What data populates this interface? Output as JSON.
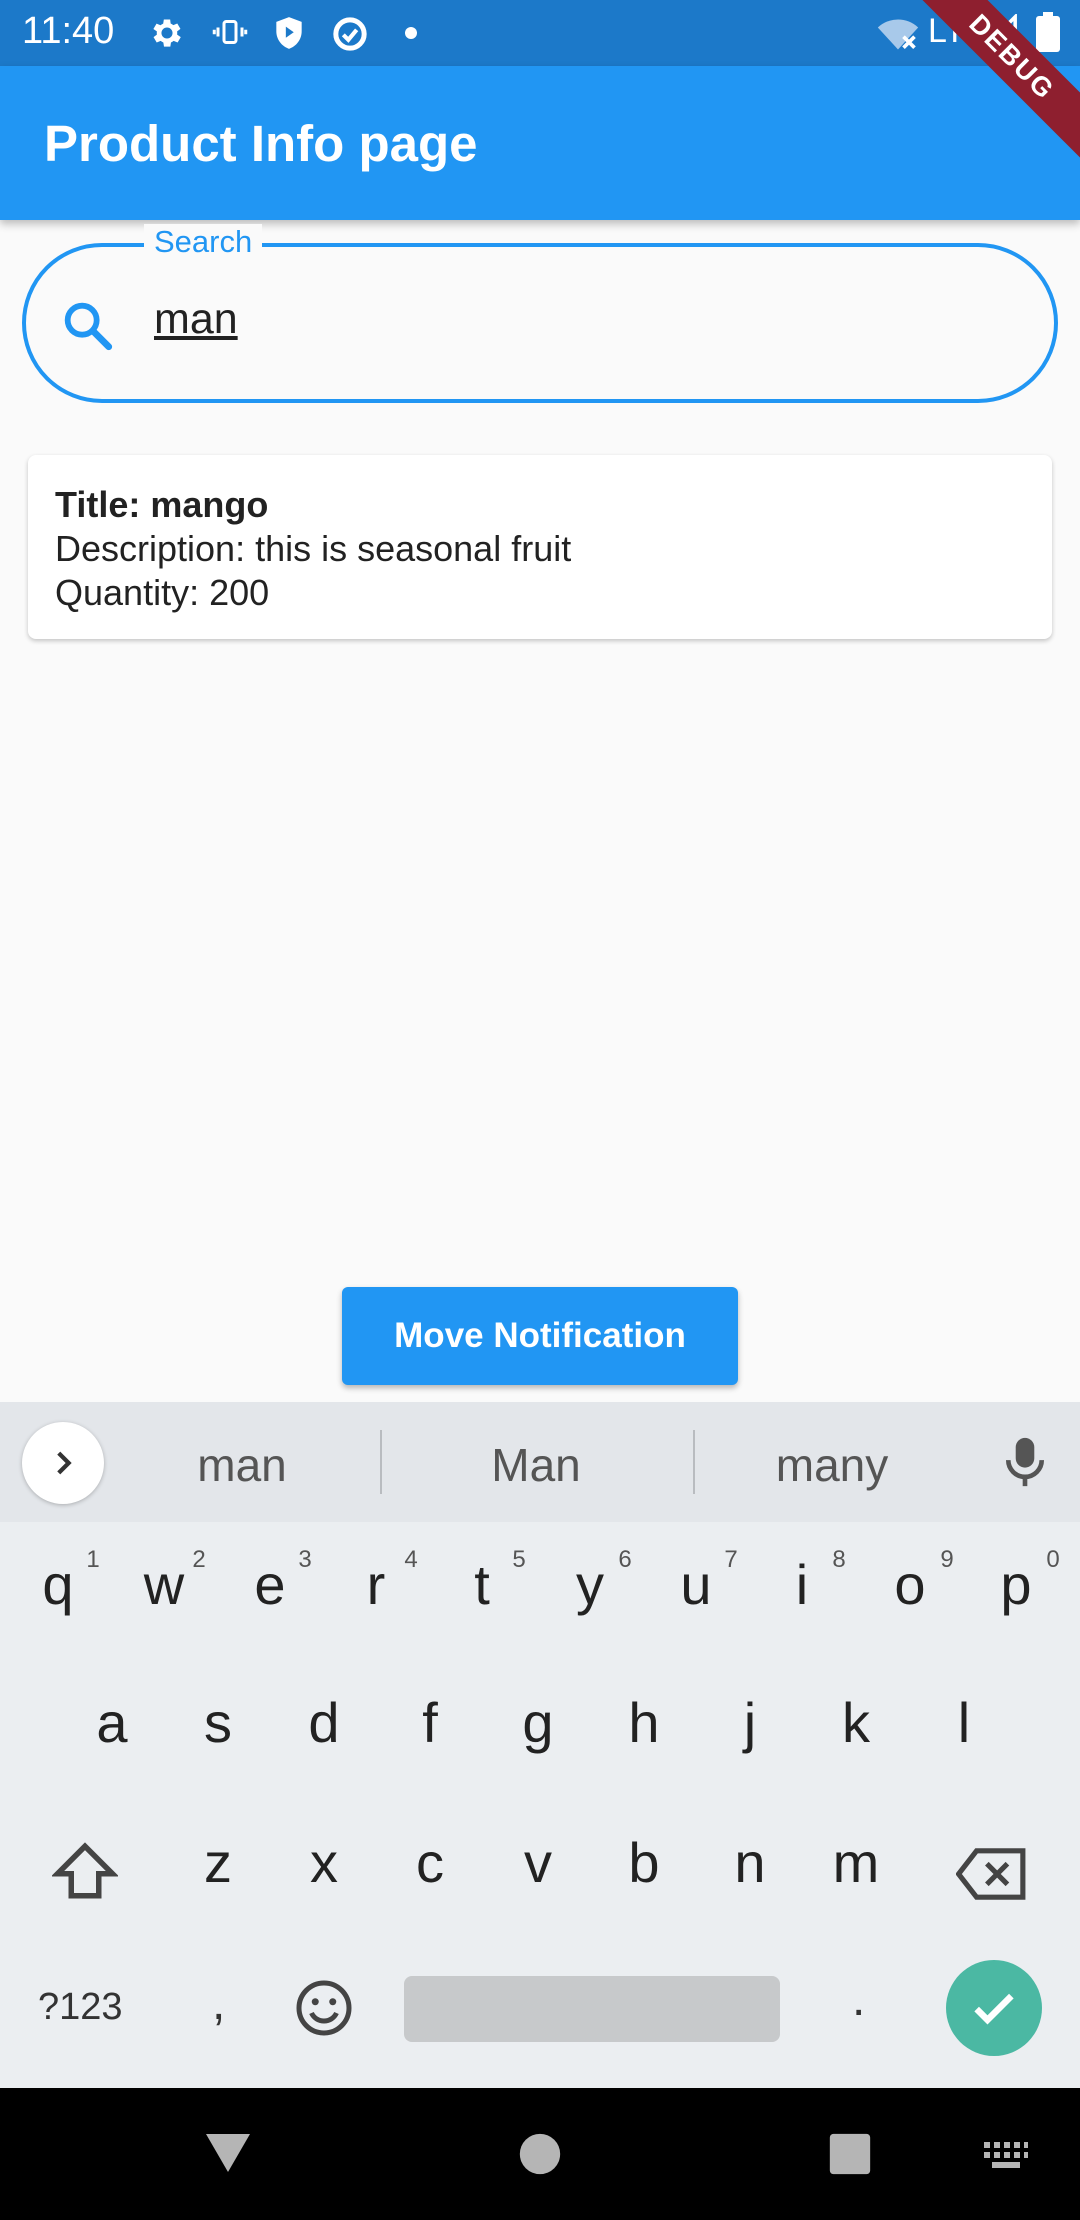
{
  "status_bar": {
    "time": "11:40",
    "network": "LTE",
    "icons": [
      "gear-icon",
      "vibrate-icon",
      "shield-icon",
      "data-saver-icon",
      "dot-icon",
      "wifi-off-icon",
      "signal-icon",
      "battery-icon"
    ]
  },
  "debug_banner": "DEBUG",
  "app_bar": {
    "title": "Product Info page"
  },
  "search": {
    "label": "Search",
    "value": "man",
    "icon": "search-icon"
  },
  "results": [
    {
      "title": "Title: mango",
      "description": "Description: this is seasonal fruit",
      "quantity": "Quantity: 200"
    }
  ],
  "notification_button": {
    "label": "Move Notification"
  },
  "keyboard": {
    "suggestions": [
      "man",
      "Man",
      "many"
    ],
    "row1": [
      "q",
      "w",
      "e",
      "r",
      "t",
      "y",
      "u",
      "i",
      "o",
      "p"
    ],
    "row1_hints": [
      "1",
      "2",
      "3",
      "4",
      "5",
      "6",
      "7",
      "8",
      "9",
      "0"
    ],
    "row2": [
      "a",
      "s",
      "d",
      "f",
      "g",
      "h",
      "j",
      "k",
      "l"
    ],
    "row3": [
      "z",
      "x",
      "c",
      "v",
      "b",
      "n",
      "m"
    ],
    "symbols_key": "?123",
    "comma_key": ",",
    "period_key": "."
  },
  "colors": {
    "primary": "#2196f3",
    "status_bar": "#1c79c9",
    "enter_key": "#4bb8a3",
    "debug_banner": "#8e1f2f"
  }
}
